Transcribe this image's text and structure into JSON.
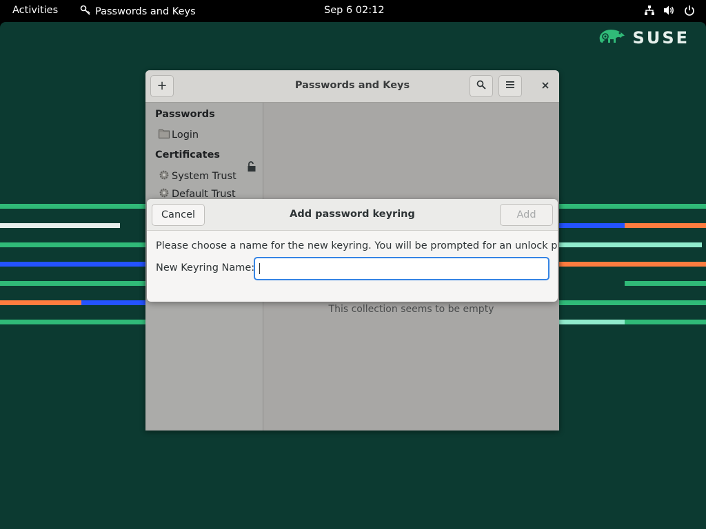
{
  "topbar": {
    "activities": "Activities",
    "app_name": "Passwords and Keys",
    "clock": "Sep 6  02:12",
    "icons": [
      "network-icon",
      "volume-icon",
      "power-icon"
    ]
  },
  "desktop": {
    "brand": "SUSE",
    "colors": {
      "background": "#0c3a31",
      "green": "#30ba78",
      "blue": "#2453ff",
      "orange": "#fe7c3f",
      "mint": "#90ebcd"
    }
  },
  "window": {
    "title": "Passwords and Keys",
    "add_label": "+",
    "sidebar": {
      "passwords_heading": "Passwords",
      "login_label": "Login",
      "certificates_heading": "Certificates",
      "system_trust_label": "System Trust",
      "default_trust_label": "Default Trust"
    },
    "empty_message": "This collection seems to be empty"
  },
  "dialog": {
    "title": "Add password keyring",
    "cancel_label": "Cancel",
    "add_label": "Add",
    "message": "Please choose a name for the new keyring. You will be prompted for an unlock password.",
    "name_label": "New Keyring Name:",
    "name_value": "",
    "focus_color": "#3584e4"
  }
}
